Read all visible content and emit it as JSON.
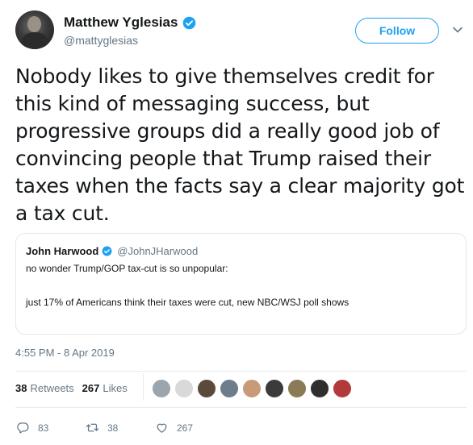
{
  "author": {
    "name": "Matthew Yglesias",
    "handle": "@mattyglesias"
  },
  "follow_label": "Follow",
  "tweet_text": "Nobody likes to give themselves credit for this kind of messaging success, but progressive groups did a really good job of convincing people that Trump raised their taxes when the facts say a clear majority got a tax cut.",
  "quoted_tweet": {
    "name": "John Harwood",
    "handle": "@JohnJHarwood",
    "line1": "no wonder Trump/GOP tax-cut is so unpopular:",
    "line2": "just 17% of Americans think their taxes were cut, new NBC/WSJ poll shows"
  },
  "timestamp": "4:55 PM - 8 Apr 2019",
  "stats": {
    "retweets_count": "38",
    "retweets_label": "Retweets",
    "likes_count": "267",
    "likes_label": "Likes"
  },
  "actions": {
    "reply_count": "83",
    "retweet_count": "38",
    "like_count": "267"
  },
  "colors": {
    "accent": "#1da1f2",
    "muted_text": "#657786",
    "text": "#14171a"
  },
  "icons": [
    "verified-badge-icon",
    "chevron-down-icon",
    "reply-icon",
    "retweet-icon",
    "heart-icon"
  ]
}
